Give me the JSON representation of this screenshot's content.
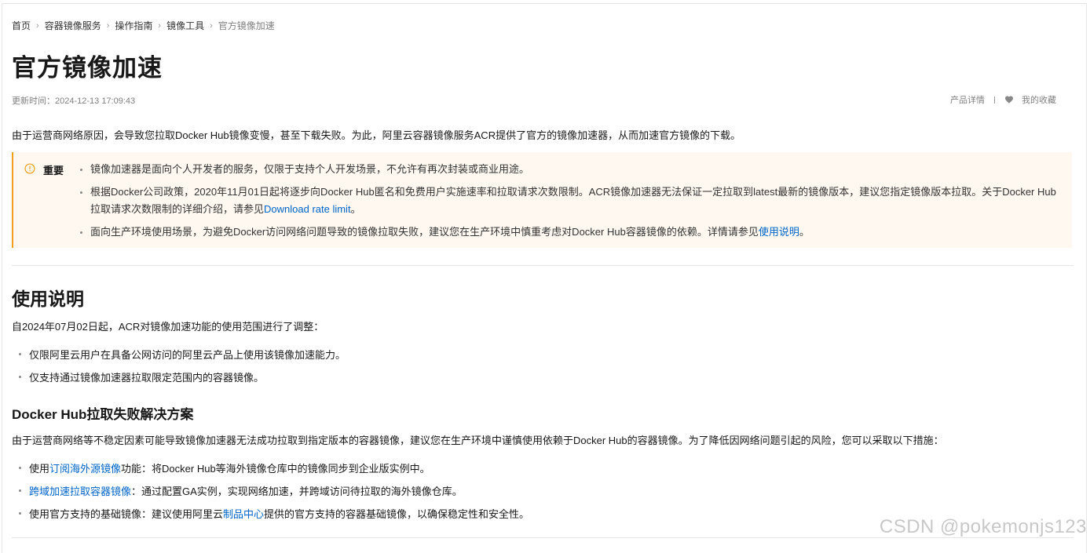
{
  "breadcrumb": [
    "首页",
    "容器镜像服务",
    "操作指南",
    "镜像工具",
    "官方镜像加速"
  ],
  "title": "官方镜像加速",
  "meta": {
    "updated_label": "更新时间：",
    "updated_time": "2024-12-13 17:09:43",
    "product_detail": "产品详情",
    "favorites": "我的收藏"
  },
  "intro": "由于运营商网络原因，会导致您拉取Docker Hub镜像变慢，甚至下载失败。为此，阿里云容器镜像服务ACR提供了官方的镜像加速器，从而加速官方镜像的下载。",
  "notice": {
    "label": "重要",
    "item1": "镜像加速器是面向个人开发者的服务，仅限于支持个人开发场景，不允许有再次封装或商业用途。",
    "item2_text": "根据Docker公司政策，2020年11月01日起将逐步向Docker Hub匿名和免费用户实施速率和拉取请求次数限制。ACR镜像加速器无法保证一定拉取到latest最新的镜像版本，建议您指定镜像版本拉取。关于Docker Hub拉取请求次数限制的详细介绍，请参见",
    "item2_link": "Download rate limit",
    "item2_end": "。",
    "item3_text": "面向生产环境使用场景，为避免Docker访问网络问题导致的镜像拉取失败，建议您在生产环境中慎重考虑对Docker Hub容器镜像的依赖。详情请参见",
    "item3_link": "使用说明",
    "item3_end": "。"
  },
  "usage": {
    "heading": "使用说明",
    "intro": "自2024年07月02日起，ACR对镜像加速功能的使用范围进行了调整：",
    "item1": "仅限阿里云用户在具备公网访问的阿里云产品上使用该镜像加速能力。",
    "item2": "仅支持通过镜像加速器拉取限定范围内的容器镜像。"
  },
  "solution": {
    "heading": "Docker Hub拉取失败解决方案",
    "intro": "由于运营商网络等不稳定因素可能导致镜像加速器无法成功拉取到指定版本的容器镜像，建议您在生产环境中谨慎使用依赖于Docker Hub的容器镜像。为了降低因网络问题引起的风险，您可以采取以下措施：",
    "item1_pre": "使用",
    "item1_link": "订阅海外源镜像",
    "item1_post": "功能：将Docker Hub等海外镜像仓库中的镜像同步到企业版实例中。",
    "item2_link": "跨域加速拉取容器镜像",
    "item2_post": "：通过配置GA实例，实现网络加速，并跨域访问待拉取的海外镜像仓库。",
    "item3_pre": "使用官方支持的基础镜像：建议使用阿里云",
    "item3_link": "制品中心",
    "item3_post": "提供的官方支持的容器基础镜像，以确保稳定性和安全性。"
  },
  "watermark": "CSDN @pokemonjs123",
  "colors": {
    "link": "#0064c8",
    "notice_bg": "#fff8f0",
    "notice_border": "#f0a020"
  }
}
